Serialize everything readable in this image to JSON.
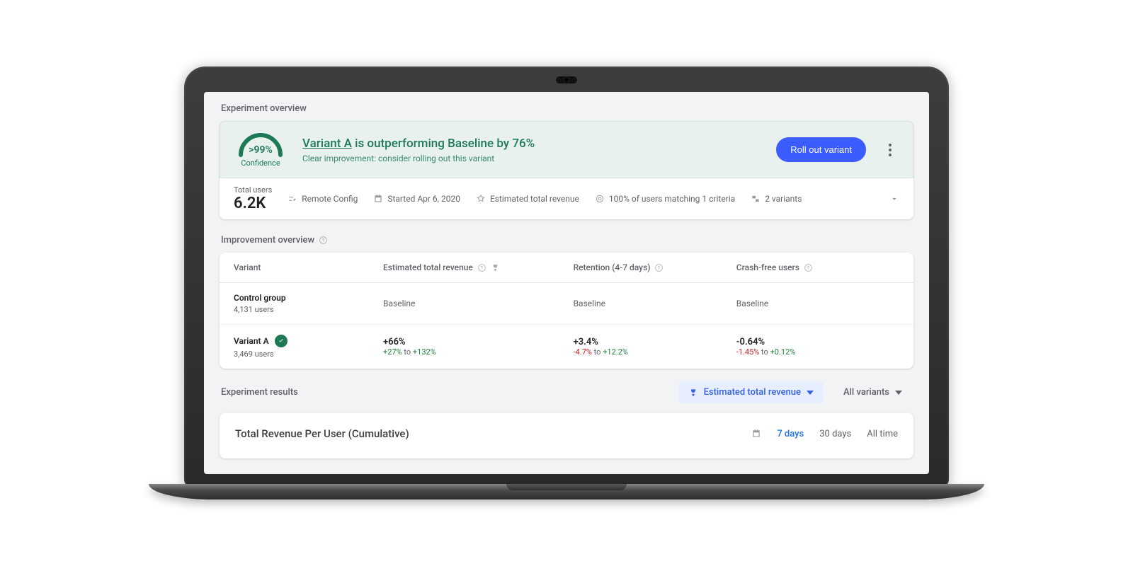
{
  "overview": {
    "section_title": "Experiment overview",
    "confidence_pct": ">99%",
    "confidence_label": "Confidence",
    "banner_variant": "Variant A",
    "banner_rest": " is outperforming Baseline by 76%",
    "banner_sub": "Clear improvement: consider rolling out this variant",
    "rollout_btn": "Roll out variant"
  },
  "summary": {
    "total_label": "Total users",
    "total_value": "6.2K",
    "remote": "Remote Config",
    "started": "Started Apr 6, 2020",
    "revenue": "Estimated total revenue",
    "matching": "100% of users matching 1 criteria",
    "variants": "2 variants"
  },
  "improvement": {
    "title": "Improvement overview",
    "cols": {
      "variant": "Variant",
      "revenue": "Estimated total revenue",
      "retention": "Retention (4-7 days)",
      "crashfree": "Crash-free users"
    },
    "rows": [
      {
        "name": "Control group",
        "users": "4,131 users",
        "winner": false,
        "revenue": {
          "primary": "Baseline"
        },
        "retention": {
          "primary": "Baseline"
        },
        "crashfree": {
          "primary": "Baseline"
        }
      },
      {
        "name": "Variant A",
        "users": "3,469 users",
        "winner": true,
        "revenue": {
          "primary": "+66%",
          "low": "+27%",
          "to": " to ",
          "high": "+132%"
        },
        "retention": {
          "primary": "+3.4%",
          "low": "-4.7%",
          "to": " to ",
          "high": "+12.2%"
        },
        "crashfree": {
          "primary": "-0.64%",
          "low": "-1.45%",
          "to": " to ",
          "high": "+0.12%"
        }
      }
    ]
  },
  "results": {
    "title": "Experiment results",
    "metric_filter": "Estimated total revenue",
    "variant_filter": "All variants",
    "chart_title": "Total Revenue Per User (Cumulative)",
    "ranges": {
      "d7": "7 days",
      "d30": "30 days",
      "all": "All time"
    }
  }
}
